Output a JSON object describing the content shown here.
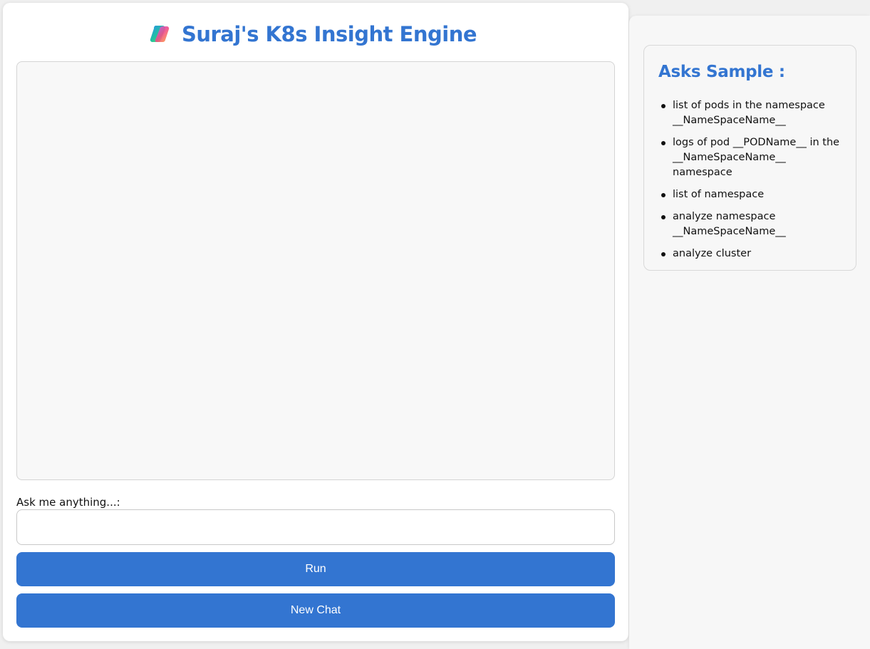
{
  "header": {
    "title": "Suraj's K8s Insight Engine",
    "logo_icon": "copilot-logo-icon"
  },
  "chat": {
    "messages": []
  },
  "input": {
    "label": "Ask me anything...:",
    "value": "",
    "placeholder": ""
  },
  "buttons": {
    "run_label": "Run",
    "new_chat_label": "New Chat"
  },
  "sidebar": {
    "title": "Asks Sample :",
    "items": [
      "list of pods in the namespace __NameSpaceName__",
      "logs of pod __PODName__ in the __NameSpaceName__ namespace",
      "list of namespace",
      "analyze namespace __NameSpaceName__",
      "analyze cluster"
    ]
  },
  "colors": {
    "accent": "#3375d1",
    "chat_bg": "#f8f8f8",
    "sidebar_bg": "#f7f7f7"
  }
}
